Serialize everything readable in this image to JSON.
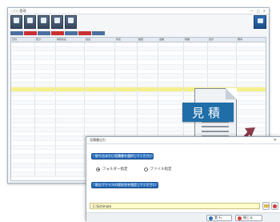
{
  "app": {
    "title": "○○○管理",
    "window_controls": [
      "—",
      "□",
      "✕"
    ],
    "toolbar": [
      {
        "label": ""
      },
      {
        "label": ""
      },
      {
        "label": ""
      },
      {
        "label": ""
      },
      {
        "label": ""
      }
    ],
    "close_label": ""
  },
  "grid": {
    "columns": [
      "日付",
      "区分",
      "得意先名",
      "担当",
      "件名",
      "数量",
      "金額",
      "税額",
      "合計",
      "備考"
    ],
    "row_count": 30
  },
  "estimate_icon": {
    "label": "見積",
    "accent": "#1f6ea8"
  },
  "dialog": {
    "title": "見積書出力",
    "close": "✕",
    "select_folder_label": "取り込みたい見積書を選択してください",
    "radio_folder": "フォルダー指定",
    "radio_file": "ファイル指定",
    "output_file_label": "取込ファイルの保存先を指定してください",
    "path_value": "C:\\Estimate",
    "footer": {
      "ok_label": "実 行",
      "cancel_label": "閉じる"
    }
  }
}
